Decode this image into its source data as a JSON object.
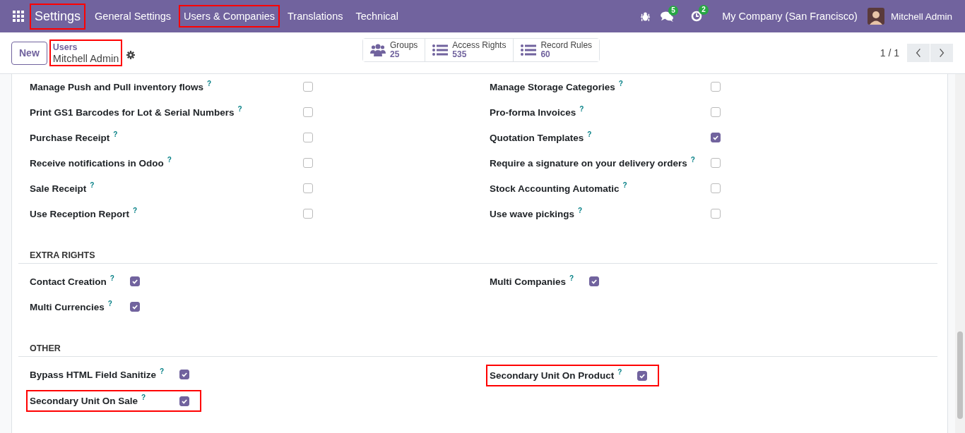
{
  "navbar": {
    "app": {
      "label": "Settings",
      "highlighted": true
    },
    "menu": [
      {
        "label": "General Settings",
        "highlighted": false
      },
      {
        "label": "Users & Companies",
        "highlighted": true
      },
      {
        "label": "Translations",
        "highlighted": false
      },
      {
        "label": "Technical",
        "highlighted": false
      }
    ],
    "messages_badge": "5",
    "activities_badge": "2",
    "company": "My Company (San Francisco)",
    "user": "Mitchell Admin"
  },
  "control_panel": {
    "new_button": "New",
    "breadcrumb": {
      "parent": "Users",
      "current": "Mitchell Admin",
      "highlighted": true
    },
    "stat_buttons": [
      {
        "kind": "groups",
        "label": "Groups",
        "value": "25"
      },
      {
        "kind": "list",
        "label": "Access Rights",
        "value": "535"
      },
      {
        "kind": "list",
        "label": "Record Rules",
        "value": "60"
      }
    ],
    "pager": "1 / 1"
  },
  "sections": [
    {
      "kind": "aligned",
      "columns": [
        [
          {
            "label": "Manage Push and Pull inventory flows",
            "help": "?",
            "checked": false,
            "highlighted": false
          },
          {
            "label": "Print GS1 Barcodes for Lot & Serial Numbers",
            "help": "?",
            "checked": false,
            "highlighted": false
          },
          {
            "label": "Purchase Receipt",
            "help": "?",
            "checked": false,
            "highlighted": false
          },
          {
            "label": "Receive notifications in Odoo",
            "help": "?",
            "checked": false,
            "highlighted": false
          },
          {
            "label": "Sale Receipt",
            "help": "?",
            "checked": false,
            "highlighted": false
          },
          {
            "label": "Use Reception Report",
            "help": "?",
            "checked": false,
            "highlighted": false
          }
        ],
        [
          {
            "label": "Manage Storage Categories",
            "help": "?",
            "checked": false,
            "highlighted": false
          },
          {
            "label": "Pro-forma Invoices",
            "help": "?",
            "checked": false,
            "highlighted": false
          },
          {
            "label": "Quotation Templates",
            "help": "?",
            "checked": true,
            "highlighted": false
          },
          {
            "label": "Require a signature on your delivery orders",
            "help": "?",
            "checked": false,
            "highlighted": false
          },
          {
            "label": "Stock Accounting Automatic",
            "help": "?",
            "checked": false,
            "highlighted": false
          },
          {
            "label": "Use wave pickings",
            "help": "?",
            "checked": false,
            "highlighted": false
          }
        ]
      ]
    },
    {
      "kind": "compact",
      "title": "EXTRA RIGHTS",
      "columns": [
        [
          {
            "label": "Contact Creation",
            "help": "?",
            "checked": true,
            "highlighted": false
          },
          {
            "label": "Multi Currencies",
            "help": "?",
            "checked": true,
            "highlighted": false
          }
        ],
        [
          {
            "label": "Multi Companies",
            "help": "?",
            "checked": true,
            "highlighted": false
          }
        ]
      ]
    },
    {
      "kind": "compact",
      "title": "OTHER",
      "columns": [
        [
          {
            "label": "Bypass HTML Field Sanitize",
            "help": "?",
            "checked": true,
            "highlighted": false
          },
          {
            "label": "Secondary Unit On Sale",
            "help": "?",
            "checked": true,
            "highlighted": true
          }
        ],
        [
          {
            "label": "Secondary Unit On Product",
            "help": "?",
            "checked": true,
            "highlighted": true
          }
        ]
      ]
    }
  ]
}
